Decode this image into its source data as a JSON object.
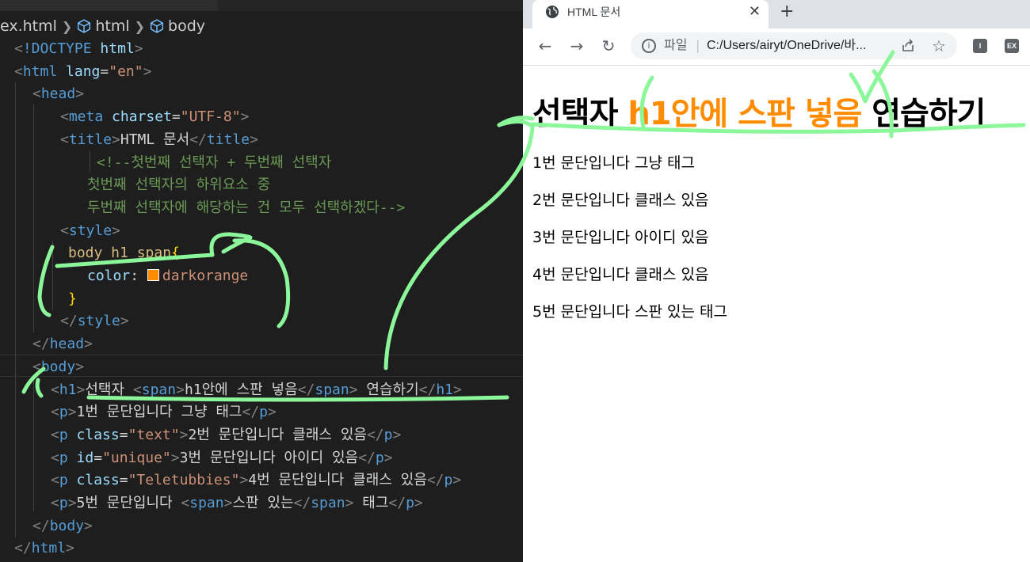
{
  "editor": {
    "breadcrumb": {
      "file": "ex.html",
      "item1": "html",
      "item2": "body"
    },
    "code": {
      "l1": {
        "lt": "<",
        "kw": "!DOCTYPE",
        "tag": "html",
        "gt": ">"
      },
      "l2": {
        "lt": "<",
        "tag": "html",
        "attr": "lang",
        "eq": "=",
        "val": "\"en\"",
        "gt": ">"
      },
      "l3": {
        "lt": "<",
        "tag": "head",
        "gt": ">"
      },
      "l4": {
        "lt": "<",
        "tag": "meta",
        "attr": "charset",
        "eq": "=",
        "val": "\"UTF-8\"",
        "gt": ">"
      },
      "l5": {
        "lt": "<",
        "tag": "title",
        "gt": ">",
        "text": "HTML 문서",
        "lt2": "</",
        "tag2": "title",
        "gt2": ">"
      },
      "l6": "<!--첫번째 선택자 + 두번째 선택자",
      "l7": "첫번째 선택자의 하위요소 중",
      "l8": "두번째 선택자에 해당하는 건 모두 선택하겠다-->",
      "l9": {
        "lt": "<",
        "tag": "style",
        "gt": ">"
      },
      "l10": {
        "selector": "body h1 span",
        "brace": "{"
      },
      "l11": {
        "prop": "color",
        "colon": ":",
        "value": "darkorange"
      },
      "l12": "}",
      "l13": {
        "lt": "</",
        "tag": "style",
        "gt": ">"
      },
      "l14": {
        "lt": "</",
        "tag": "head",
        "gt": ">"
      },
      "l15": {
        "lt": "<",
        "tag": "body",
        "gt": ">"
      },
      "l16": {
        "lt": "<",
        "tag": "h1",
        "gt": ">",
        "text1": "선택자 ",
        "slt": "<",
        "stag": "span",
        "sgt": ">",
        "text2": "h1안에 스판 넣음",
        "slt2": "</",
        "stag2": "span",
        "sgt2": ">",
        "text3": " 연습하기",
        "lt2": "</",
        "tag2": "h1",
        "gt2": ">"
      },
      "l17": {
        "lt": "<",
        "tag": "p",
        "gt": ">",
        "text": "1번 문단입니다 그냥 태그",
        "lt2": "</",
        "tag2": "p",
        "gt2": ">"
      },
      "l18": {
        "lt": "<",
        "tag": "p",
        "attr": "class",
        "eq": "=",
        "val": "\"text\"",
        "gt": ">",
        "text": "2번 문단입니다 클래스 있음",
        "lt2": "</",
        "tag2": "p",
        "gt2": ">"
      },
      "l19": {
        "lt": "<",
        "tag": "p",
        "attr": "id",
        "eq": "=",
        "val": "\"unique\"",
        "gt": ">",
        "text": "3번 문단입니다 아이디 있음",
        "lt2": "</",
        "tag2": "p",
        "gt2": ">"
      },
      "l20": {
        "lt": "<",
        "tag": "p",
        "attr": "class",
        "eq": "=",
        "val": "\"Teletubbies\"",
        "gt": ">",
        "text": "4번 문단입니다 클래스 있음",
        "lt2": "</",
        "tag2": "p",
        "gt2": ">"
      },
      "l21": {
        "lt": "<",
        "tag": "p",
        "gt": ">",
        "text1": "5번 문단입니다 ",
        "slt": "<",
        "stag": "span",
        "sgt": ">",
        "text2": "스판 있는",
        "slt2": "</",
        "stag2": "span",
        "sgt2": ">",
        "text3": " 태그",
        "lt2": "</",
        "tag2": "p",
        "gt2": ">"
      },
      "l22": {
        "lt": "</",
        "tag": "body",
        "gt": ">"
      },
      "l23": {
        "lt": "</",
        "tag": "html",
        "gt": ">"
      }
    }
  },
  "browser": {
    "tab_title": "HTML 문서",
    "tab_close": "✕",
    "new_tab": "+",
    "nav": {
      "back": "←",
      "forward": "→",
      "reload": "↻"
    },
    "omnibox": {
      "info": "i",
      "label": "파일",
      "sep": "|",
      "url": "C:/Users/airyt/OneDrive/바...",
      "star": "☆"
    },
    "extensions": {
      "ext1": "I",
      "ext2": "EX"
    },
    "page": {
      "h1_before": "선택자 ",
      "h1_span": "h1안에 스판 넣음",
      "h1_after": " 연습하기",
      "paragraphs": [
        "1번 문단입니다 그냥 태그",
        "2번 문단입니다 클래스 있음",
        "3번 문단입니다 아이디 있음",
        "4번 문단입니다 클래스 있음",
        "5번 문단입니다 스판 있는 태그"
      ]
    }
  },
  "colors": {
    "accent": "#ff8c00",
    "annotation": "#8cf79a"
  }
}
